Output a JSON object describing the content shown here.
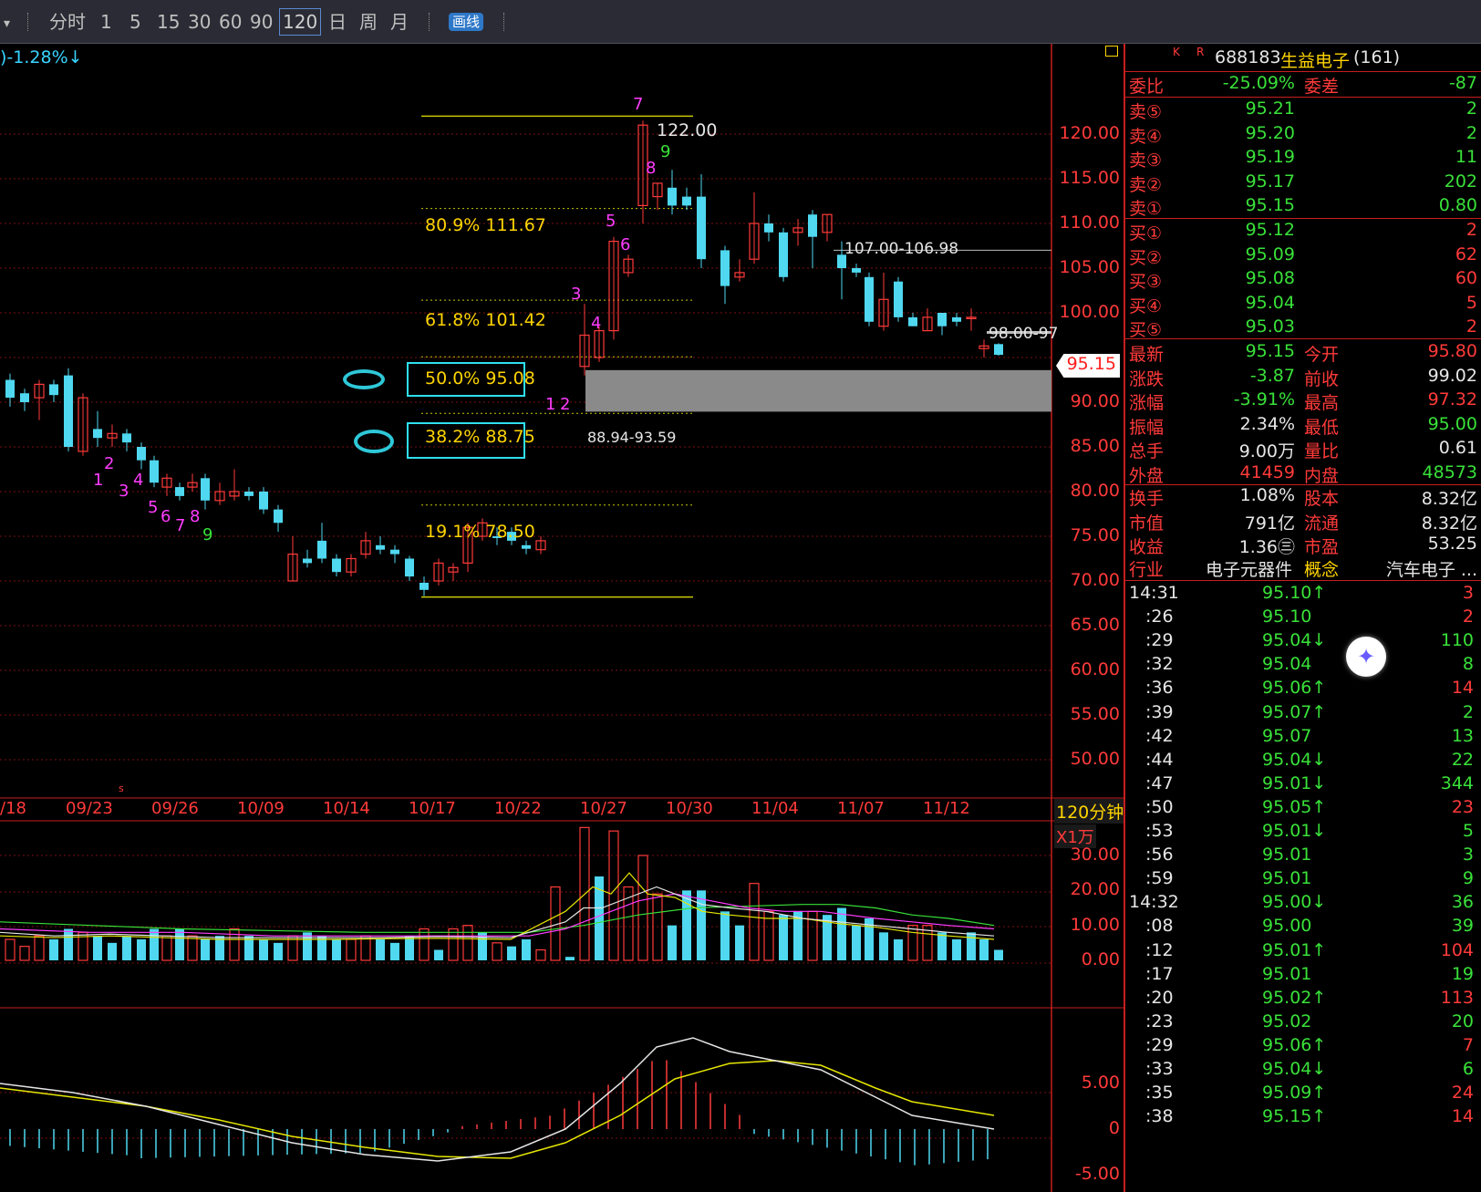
{
  "toolbar": {
    "items": [
      "分时",
      "1",
      "5",
      "15",
      "30",
      "60",
      "90",
      "120",
      "日",
      "周",
      "月"
    ],
    "active": "120",
    "draw_label": "画线"
  },
  "chart": {
    "top_info": ")-1.28%↓",
    "price_axis": [
      "120.00",
      "115.00",
      "110.00",
      "105.00",
      "100.00",
      "95.15",
      "90.00",
      "85.00",
      "80.00",
      "75.00",
      "70.00",
      "65.00",
      "60.00",
      "55.00",
      "50.00"
    ],
    "current_price_tag": "95.15",
    "dates": [
      "/18",
      "09/23",
      "09/26",
      "10/09",
      "10/14",
      "10/17",
      "10/22",
      "10/27",
      "10/30",
      "11/04",
      "11/07",
      "11/12"
    ],
    "period_label": "120分钟",
    "fib": [
      {
        "label": "80.9% 111.67"
      },
      {
        "label": "61.8% 101.42"
      },
      {
        "label": "50.0% 95.08"
      },
      {
        "label": "38.2% 88.75"
      },
      {
        "label": "19.1% 78.50"
      }
    ],
    "high_label": "122.00",
    "resist1": "107.00-106.98",
    "resist2": "98.00-97",
    "gap_label": "88.94-93.59",
    "counts_down": [
      "1",
      "2",
      "3",
      "4",
      "5",
      "6",
      "7",
      "8",
      "9"
    ],
    "counts_up": [
      "1",
      "2",
      "3",
      "4",
      "5",
      "6",
      "7",
      "8",
      "9"
    ],
    "marker_s": "s",
    "volume_unit": "X1万",
    "volume_axis": [
      "30.00",
      "20.00",
      "10.00",
      "0.00"
    ],
    "macd_axis": [
      "5.00",
      "0",
      "-5.00"
    ]
  },
  "panel": {
    "header": {
      "k": "K",
      "r": "R",
      "code": "688183",
      "name": "生益电子",
      "count": "(161)"
    },
    "weibi": {
      "label": "委比",
      "value": "-25.09%",
      "label2": "委差",
      "value2": "-87"
    },
    "sell": [
      {
        "label": "卖⑤",
        "price": "95.21",
        "vol": "2"
      },
      {
        "label": "卖④",
        "price": "95.20",
        "vol": "2"
      },
      {
        "label": "卖③",
        "price": "95.19",
        "vol": "11"
      },
      {
        "label": "卖②",
        "price": "95.17",
        "vol": "202"
      },
      {
        "label": "卖①",
        "price": "95.15",
        "vol": "0.80"
      }
    ],
    "buy": [
      {
        "label": "买①",
        "price": "95.12",
        "vol": "2"
      },
      {
        "label": "买②",
        "price": "95.09",
        "vol": "62"
      },
      {
        "label": "买③",
        "price": "95.08",
        "vol": "60"
      },
      {
        "label": "买④",
        "price": "95.04",
        "vol": "5"
      },
      {
        "label": "买⑤",
        "price": "95.03",
        "vol": "2"
      }
    ],
    "stats": [
      {
        "l1": "最新",
        "v1": "95.15",
        "l2": "今开",
        "v2": "95.80"
      },
      {
        "l1": "涨跌",
        "v1": "-3.87",
        "l2": "前收",
        "v2": "99.02"
      },
      {
        "l1": "涨幅",
        "v1": "-3.91%",
        "l2": "最高",
        "v2": "97.32"
      },
      {
        "l1": "振幅",
        "v1": "2.34%",
        "l2": "最低",
        "v2": "95.00"
      },
      {
        "l1": "总手",
        "v1": "9.00万",
        "l2": "量比",
        "v2": "0.61"
      },
      {
        "l1": "外盘",
        "v1": "41459",
        "l2": "内盘",
        "v2": "48573"
      }
    ],
    "stats2": [
      {
        "l1": "换手",
        "v1": "1.08%",
        "l2": "股本",
        "v2": "8.32亿"
      },
      {
        "l1": "市值",
        "v1": "791亿",
        "l2": "流通",
        "v2": "8.32亿"
      },
      {
        "l1": "收益",
        "v1": "1.36㊂",
        "l2": "市盈",
        "v2": "53.25"
      }
    ],
    "industry": {
      "label": "行业",
      "value": "电子元器件",
      "label2": "概念",
      "value2": "汽车电子 ..."
    },
    "ticks": [
      {
        "t": "14:31",
        "p": "95.10↑",
        "v": "3",
        "c": "red"
      },
      {
        "t": ":26",
        "p": "95.10",
        "v": "2",
        "c": "red"
      },
      {
        "t": ":29",
        "p": "95.04↓",
        "v": "110",
        "c": "green"
      },
      {
        "t": ":32",
        "p": "95.04",
        "v": "8",
        "c": "green"
      },
      {
        "t": ":36",
        "p": "95.06↑",
        "v": "14",
        "c": "red"
      },
      {
        "t": ":39",
        "p": "95.07↑",
        "v": "2",
        "c": "green"
      },
      {
        "t": ":42",
        "p": "95.07",
        "v": "13",
        "c": "green"
      },
      {
        "t": ":44",
        "p": "95.04↓",
        "v": "22",
        "c": "green"
      },
      {
        "t": ":47",
        "p": "95.01↓",
        "v": "344",
        "c": "green"
      },
      {
        "t": ":50",
        "p": "95.05↑",
        "v": "23",
        "c": "red"
      },
      {
        "t": ":53",
        "p": "95.01↓",
        "v": "5",
        "c": "green"
      },
      {
        "t": ":56",
        "p": "95.01",
        "v": "3",
        "c": "green"
      },
      {
        "t": ":59",
        "p": "95.01",
        "v": "9",
        "c": "green"
      },
      {
        "t": "14:32",
        "p": "95.00↓",
        "v": "36",
        "c": "green"
      },
      {
        "t": ":08",
        "p": "95.00",
        "v": "39",
        "c": "green"
      },
      {
        "t": ":12",
        "p": "95.01↑",
        "v": "104",
        "c": "red"
      },
      {
        "t": ":17",
        "p": "95.01",
        "v": "19",
        "c": "green"
      },
      {
        "t": ":20",
        "p": "95.02↑",
        "v": "113",
        "c": "red"
      },
      {
        "t": ":23",
        "p": "95.02",
        "v": "20",
        "c": "green"
      },
      {
        "t": ":29",
        "p": "95.06↑",
        "v": "7",
        "c": "red"
      },
      {
        "t": ":33",
        "p": "95.04↓",
        "v": "6",
        "c": "green"
      },
      {
        "t": ":35",
        "p": "95.09↑",
        "v": "24",
        "c": "red"
      },
      {
        "t": ":38",
        "p": "95.15↑",
        "v": "14",
        "c": "red"
      }
    ]
  }
}
